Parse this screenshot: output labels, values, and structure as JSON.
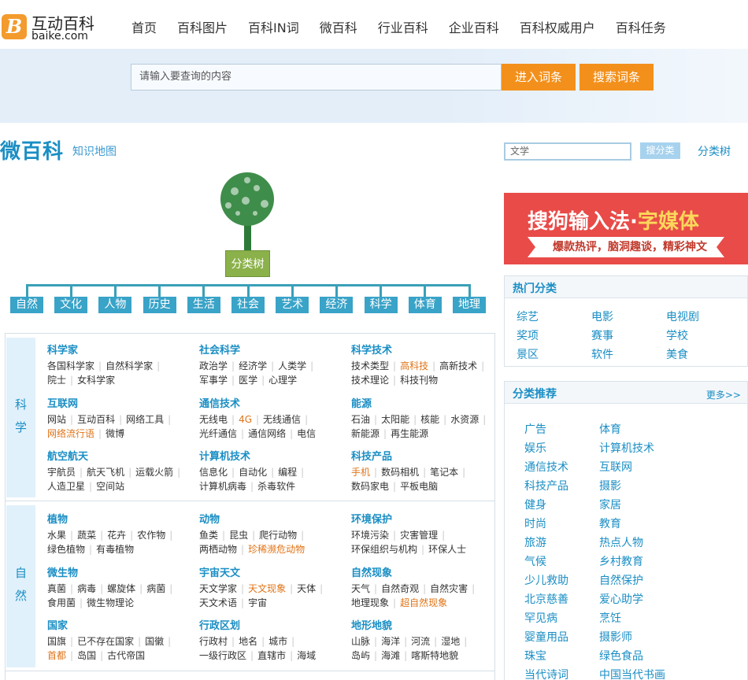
{
  "header": {
    "logo_mark": "B",
    "logo_text": "互动百科",
    "logo_domain": "baike.com",
    "nav": [
      "首页",
      "百科图片",
      "百科IN词",
      "微百科",
      "行业百科",
      "企业百科",
      "百科权威用户",
      "百科任务"
    ]
  },
  "search": {
    "placeholder": "请输入要查询的内容",
    "enter_label": "进入词条",
    "search_label": "搜索词条"
  },
  "page": {
    "title": "微百科",
    "knowledge_map": "知识地图"
  },
  "filter": {
    "value": "文学",
    "button": "搜分类",
    "tree_link": "分类树"
  },
  "tree": {
    "root": "分类树",
    "categories": [
      "自然",
      "文化",
      "人物",
      "历史",
      "生活",
      "社会",
      "艺术",
      "经济",
      "科学",
      "体育",
      "地理"
    ]
  },
  "sections": [
    {
      "side": "科学",
      "groups": [
        {
          "title": "科学家",
          "items": [
            {
              "t": "各国科学家"
            },
            {
              "t": "自然科学家"
            },
            {
              "t": "院士"
            },
            {
              "t": "女科学家"
            }
          ]
        },
        {
          "title": "社会科学",
          "items": [
            {
              "t": "政治学"
            },
            {
              "t": "经济学"
            },
            {
              "t": "人类学"
            },
            {
              "t": "军事学"
            },
            {
              "t": "医学"
            },
            {
              "t": "心理学"
            }
          ]
        },
        {
          "title": "科学技术",
          "items": [
            {
              "t": "技术类型"
            },
            {
              "t": "高科技",
              "hot": true
            },
            {
              "t": "高新技术"
            },
            {
              "t": "技术理论"
            },
            {
              "t": "科技刊物"
            }
          ]
        },
        {
          "title": "互联网",
          "items": [
            {
              "t": "网站"
            },
            {
              "t": "互动百科"
            },
            {
              "t": "网络工具"
            },
            {
              "t": "网络流行语",
              "hot": true
            },
            {
              "t": "微博"
            }
          ]
        },
        {
          "title": "通信技术",
          "items": [
            {
              "t": "无线电"
            },
            {
              "t": "4G",
              "hot": true
            },
            {
              "t": "无线通信"
            },
            {
              "t": "光纤通信"
            },
            {
              "t": "通信网络"
            },
            {
              "t": "电信"
            }
          ]
        },
        {
          "title": "能源",
          "items": [
            {
              "t": "石油"
            },
            {
              "t": "太阳能"
            },
            {
              "t": "核能"
            },
            {
              "t": "水资源"
            },
            {
              "t": "新能源"
            },
            {
              "t": "再生能源"
            }
          ]
        },
        {
          "title": "航空航天",
          "items": [
            {
              "t": "宇航员"
            },
            {
              "t": "航天飞机"
            },
            {
              "t": "运载火箭"
            },
            {
              "t": "人造卫星"
            },
            {
              "t": "空间站"
            }
          ]
        },
        {
          "title": "计算机技术",
          "items": [
            {
              "t": "信息化"
            },
            {
              "t": "自动化"
            },
            {
              "t": "编程"
            },
            {
              "t": "计算机病毒"
            },
            {
              "t": "杀毒软件"
            }
          ]
        },
        {
          "title": "科技产品",
          "items": [
            {
              "t": "手机",
              "hot": true
            },
            {
              "t": "数码相机"
            },
            {
              "t": "笔记本"
            },
            {
              "t": "数码家电"
            },
            {
              "t": "平板电脑"
            }
          ]
        }
      ]
    },
    {
      "side": "自然",
      "groups": [
        {
          "title": "植物",
          "items": [
            {
              "t": "水果"
            },
            {
              "t": "蔬菜"
            },
            {
              "t": "花卉"
            },
            {
              "t": "农作物"
            },
            {
              "t": "绿色植物"
            },
            {
              "t": "有毒植物"
            }
          ]
        },
        {
          "title": "动物",
          "items": [
            {
              "t": "鱼类"
            },
            {
              "t": "昆虫"
            },
            {
              "t": "爬行动物"
            },
            {
              "t": "两栖动物"
            },
            {
              "t": "珍稀濒危动物",
              "hot": true
            }
          ]
        },
        {
          "title": "环境保护",
          "items": [
            {
              "t": "环境污染"
            },
            {
              "t": "灾害管理"
            },
            {
              "t": "环保组织与机构"
            },
            {
              "t": "环保人士"
            }
          ]
        },
        {
          "title": "微生物",
          "items": [
            {
              "t": "真菌"
            },
            {
              "t": "病毒"
            },
            {
              "t": "螺旋体"
            },
            {
              "t": "病菌"
            },
            {
              "t": "食用菌"
            },
            {
              "t": "微生物理论"
            }
          ]
        },
        {
          "title": "宇宙天文",
          "items": [
            {
              "t": "天文学家"
            },
            {
              "t": "天文现象",
              "hot": true
            },
            {
              "t": "天体"
            },
            {
              "t": "天文术语"
            },
            {
              "t": "宇宙"
            }
          ]
        },
        {
          "title": "自然现象",
          "items": [
            {
              "t": "天气"
            },
            {
              "t": "自然奇观"
            },
            {
              "t": "自然灾害"
            },
            {
              "t": "地理现象"
            },
            {
              "t": "超自然现象",
              "hot": true
            }
          ]
        },
        {
          "title": "国家",
          "items": [
            {
              "t": "国旗"
            },
            {
              "t": "已不存在国家"
            },
            {
              "t": "国徽"
            },
            {
              "t": "首都",
              "hot": true
            },
            {
              "t": "岛国"
            },
            {
              "t": "古代帝国"
            }
          ]
        },
        {
          "title": "行政区划",
          "items": [
            {
              "t": "行政村"
            },
            {
              "t": "地名"
            },
            {
              "t": "城市"
            },
            {
              "t": "一级行政区"
            },
            {
              "t": "直辖市"
            },
            {
              "t": "海域"
            }
          ]
        },
        {
          "title": "地形地貌",
          "items": [
            {
              "t": "山脉"
            },
            {
              "t": "海洋"
            },
            {
              "t": "河流"
            },
            {
              "t": "湿地"
            },
            {
              "t": "岛屿"
            },
            {
              "t": "海滩"
            },
            {
              "t": "喀斯特地貌"
            }
          ]
        }
      ]
    }
  ],
  "ad": {
    "line1_a": "搜狗输入法",
    "line1_sep": "·",
    "line1_b": "字媒体",
    "line2": "爆款热评，脑洞趣谈，精彩神文"
  },
  "hot": {
    "title": "热门分类",
    "items": [
      "综艺",
      "电影",
      "电视剧",
      "奖项",
      "赛事",
      "学校",
      "景区",
      "软件",
      "美食"
    ]
  },
  "rec": {
    "title": "分类推荐",
    "more": "更多>>",
    "items": [
      "广告",
      "体育",
      "娱乐",
      "计算机技术",
      "通信技术",
      "互联网",
      "科技产品",
      "摄影",
      "健身",
      "家居",
      "时尚",
      "教育",
      "旅游",
      "热点人物",
      "气候",
      "乡村教育",
      "少儿救助",
      "自然保护",
      "北京慈善",
      "爱心助学",
      "罕见病",
      "烹饪",
      "婴童用品",
      "摄影师",
      "珠宝",
      "绿色食品",
      "当代诗词",
      "中国当代书画"
    ]
  },
  "colors": {
    "accent": "#1a8ec4",
    "orange": "#f3901c",
    "tree_green": "#8bb14a",
    "hot": "#e07418"
  }
}
